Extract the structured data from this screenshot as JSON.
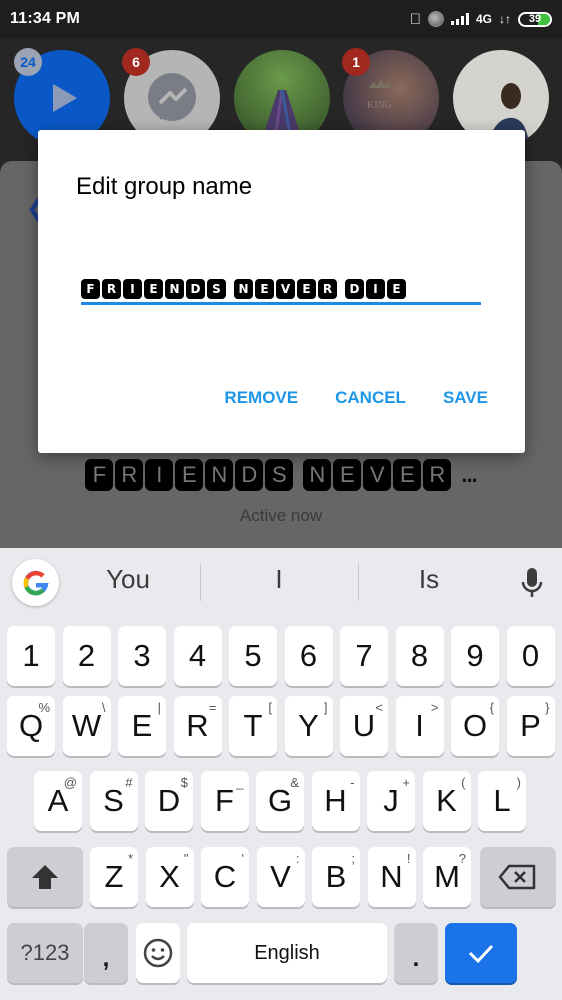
{
  "status_bar": {
    "time": "11:34 PM",
    "network": "4G",
    "battery_level": "39",
    "icons": [
      "apple-icon",
      "alarm-icon",
      "signal-icon",
      "data-transfer-icon",
      "battery-icon"
    ]
  },
  "background": {
    "stories": [
      {
        "type": "video",
        "badge": "24",
        "color": "#0a58c8"
      },
      {
        "type": "messenger",
        "badge": "6",
        "color": "#bdbdbd"
      },
      {
        "type": "photo-tree",
        "badge": "",
        "color": "#4a7a3a"
      },
      {
        "type": "photo-couple",
        "badge": "1",
        "color": "#3a3550"
      },
      {
        "type": "photo-person",
        "badge": "",
        "color": "#d8d6d0"
      }
    ],
    "conversation_title_letters": [
      "F",
      "R",
      "I",
      "E",
      "N",
      "D",
      "S",
      " ",
      "N",
      "E",
      "V",
      "E",
      "R"
    ],
    "title_overflow": "...",
    "active_status": "Active now"
  },
  "dialog": {
    "title": "Edit group name",
    "input_letters": [
      "F",
      "R",
      "I",
      "E",
      "N",
      "D",
      "S",
      " ",
      "N",
      "E",
      "V",
      "E",
      "R",
      " ",
      "D",
      "I",
      "E"
    ],
    "input_value": "FRIENDS NEVER DIE",
    "buttons": {
      "remove": "REMOVE",
      "cancel": "CANCEL",
      "save": "SAVE"
    },
    "accent_color": "#1e96e8"
  },
  "keyboard": {
    "suggestions": [
      "You",
      "I",
      "Is"
    ],
    "number_row": [
      "1",
      "2",
      "3",
      "4",
      "5",
      "6",
      "7",
      "8",
      "9",
      "0"
    ],
    "row1": [
      {
        "k": "Q",
        "a": "%"
      },
      {
        "k": "W",
        "a": "\\"
      },
      {
        "k": "E",
        "a": "|"
      },
      {
        "k": "R",
        "a": "="
      },
      {
        "k": "T",
        "a": "["
      },
      {
        "k": "Y",
        "a": "]"
      },
      {
        "k": "U",
        "a": "<"
      },
      {
        "k": "I",
        "a": ">"
      },
      {
        "k": "O",
        "a": "{"
      },
      {
        "k": "P",
        "a": "}"
      }
    ],
    "row2": [
      {
        "k": "A",
        "a": "@"
      },
      {
        "k": "S",
        "a": "#"
      },
      {
        "k": "D",
        "a": "$"
      },
      {
        "k": "F",
        "a": "_"
      },
      {
        "k": "G",
        "a": "&"
      },
      {
        "k": "H",
        "a": "-"
      },
      {
        "k": "J",
        "a": "+"
      },
      {
        "k": "K",
        "a": "("
      },
      {
        "k": "L",
        "a": ")"
      }
    ],
    "row3": [
      {
        "k": "Z",
        "a": "*"
      },
      {
        "k": "X",
        "a": "\""
      },
      {
        "k": "C",
        "a": "'"
      },
      {
        "k": "V",
        "a": ":"
      },
      {
        "k": "B",
        "a": ";"
      },
      {
        "k": "N",
        "a": "!"
      },
      {
        "k": "M",
        "a": "?"
      }
    ],
    "symbols_label": "?123",
    "comma": ",",
    "space_label": "English",
    "period": ".",
    "enter_color": "#1a73e8"
  }
}
